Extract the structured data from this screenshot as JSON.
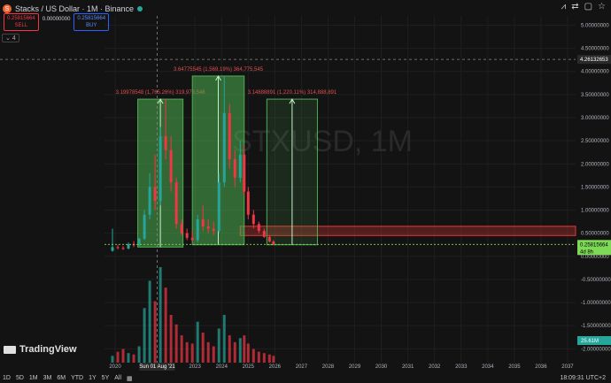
{
  "header": {
    "symbol_letter": "S",
    "title": "Stacks / US Dollar · 1M · Binance"
  },
  "trade": {
    "sell_price": "0.25815664",
    "sell_label": "SELL",
    "spread": "0.00000000",
    "buy_price": "0.25815664",
    "buy_label": "BUY"
  },
  "indicator_badge": "4",
  "toolbar_icons": [
    "trend-icon",
    "compare-icon",
    "square-icon",
    "star-icon"
  ],
  "logo_text": "TradingView",
  "bottom": {
    "periods": [
      "1D",
      "5D",
      "1M",
      "3M",
      "6M",
      "YTD",
      "1Y",
      "5Y",
      "All"
    ],
    "clock": "18:09:31 UTC+2"
  },
  "colors": {
    "up": "#26a69a",
    "down": "#f23645",
    "range_fill": "#4caf50",
    "resistance": "#e53935",
    "price_tag": "#7ed957",
    "volume_tag": "#26a69a"
  },
  "chart_data": {
    "type": "candlestick",
    "watermark": "STXUSD, 1M",
    "ylim": [
      -2.3,
      5.2
    ],
    "yticks": [
      {
        "v": 5.0,
        "label": "5.00000000"
      },
      {
        "v": 4.5,
        "label": "4.50000000"
      },
      {
        "v": 4.0,
        "label": "4.00000000"
      },
      {
        "v": 3.5,
        "label": "3.50000000"
      },
      {
        "v": 3.0,
        "label": "3.00000000"
      },
      {
        "v": 2.5,
        "label": "2.50000000"
      },
      {
        "v": 2.0,
        "label": "2.00000000"
      },
      {
        "v": 1.5,
        "label": "1.50000000"
      },
      {
        "v": 1.0,
        "label": "1.00000000"
      },
      {
        "v": 0.5,
        "label": "0.50000000"
      },
      {
        "v": 0.0,
        "label": "0.00000000"
      },
      {
        "v": -0.5,
        "label": "-0.50000000"
      },
      {
        "v": -1.0,
        "label": "-1.00000000"
      },
      {
        "v": -1.5,
        "label": "-1.50000000"
      },
      {
        "v": -2.0,
        "label": "-2.00000000"
      }
    ],
    "xlim": [
      2019.6,
      2037.3
    ],
    "xticks": [
      {
        "v": 2020,
        "label": "2020"
      },
      {
        "v": 2023,
        "label": "2023"
      },
      {
        "v": 2024,
        "label": "2024"
      },
      {
        "v": 2025,
        "label": "2025"
      },
      {
        "v": 2026,
        "label": "2026"
      },
      {
        "v": 2027,
        "label": "2027"
      },
      {
        "v": 2028,
        "label": "2028"
      },
      {
        "v": 2029,
        "label": "2029"
      },
      {
        "v": 2030,
        "label": "2030"
      },
      {
        "v": 2031,
        "label": "2031"
      },
      {
        "v": 2032,
        "label": "2032"
      },
      {
        "v": 2033,
        "label": "2033"
      },
      {
        "v": 2034,
        "label": "2034"
      },
      {
        "v": 2035,
        "label": "2035"
      },
      {
        "v": 2036,
        "label": "2036"
      },
      {
        "v": 2037,
        "label": "2037"
      }
    ],
    "crosshair": {
      "x": 2021.58,
      "y": 4.26,
      "x_label": "Sun 01 Aug '21",
      "y_label": "4.26132653"
    },
    "current_price": {
      "v": 0.258,
      "label": "0.25815664",
      "countdown": "4d 8h"
    },
    "volume_label": "25.61M",
    "resistance_zone": {
      "x0": 2024.7,
      "x1": 2037.3,
      "y0": 0.45,
      "y1": 0.65
    },
    "ranges": [
      {
        "x0": 2020.85,
        "x1": 2022.55,
        "y0": 0.2,
        "y1": 3.4,
        "label": "3.19978548 (1,765.26%) 319,978,548"
      },
      {
        "x0": 2022.9,
        "x1": 2024.85,
        "y0": 0.25,
        "y1": 3.9,
        "label": "3.64775545 (1,569.19%) 364,775,545"
      },
      {
        "x0": 2025.7,
        "x1": 2027.6,
        "y0": 0.25,
        "y1": 3.4,
        "label": "3.14888891 (1,220.11%) 314,888,891"
      }
    ],
    "series": [
      {
        "name": "",
        "points": [
          [
            2019.9,
            0.12,
            0.6,
            0.1,
            0.2
          ],
          [
            2020.1,
            0.2,
            0.25,
            0.15,
            0.18
          ],
          [
            2020.3,
            0.18,
            0.22,
            0.14,
            0.17
          ],
          [
            2020.5,
            0.17,
            0.3,
            0.15,
            0.26
          ],
          [
            2020.7,
            0.26,
            0.33,
            0.2,
            0.24
          ],
          [
            2020.9,
            0.24,
            0.4,
            0.22,
            0.38
          ],
          [
            2021.1,
            0.38,
            1.0,
            0.35,
            0.9
          ],
          [
            2021.3,
            0.9,
            1.8,
            0.8,
            1.5
          ],
          [
            2021.5,
            1.5,
            2.2,
            1.0,
            1.2
          ],
          [
            2021.7,
            1.2,
            2.8,
            1.1,
            2.6
          ],
          [
            2021.9,
            2.6,
            3.4,
            2.1,
            2.3
          ],
          [
            2022.1,
            2.3,
            2.6,
            1.4,
            1.6
          ],
          [
            2022.3,
            1.6,
            1.7,
            0.6,
            0.7
          ],
          [
            2022.5,
            0.7,
            0.8,
            0.45,
            0.5
          ],
          [
            2022.7,
            0.5,
            0.6,
            0.35,
            0.4
          ],
          [
            2022.9,
            0.4,
            0.55,
            0.3,
            0.35
          ],
          [
            2023.1,
            0.35,
            0.9,
            0.3,
            0.8
          ],
          [
            2023.3,
            0.8,
            1.1,
            0.55,
            0.65
          ],
          [
            2023.5,
            0.65,
            0.8,
            0.5,
            0.6
          ],
          [
            2023.7,
            0.6,
            0.75,
            0.45,
            0.55
          ],
          [
            2023.9,
            0.55,
            1.8,
            0.5,
            1.6
          ],
          [
            2024.1,
            1.6,
            3.9,
            1.5,
            3.1
          ],
          [
            2024.3,
            3.1,
            3.3,
            1.9,
            2.1
          ],
          [
            2024.5,
            2.1,
            2.3,
            1.5,
            1.7
          ],
          [
            2024.7,
            1.7,
            2.5,
            1.6,
            2.2
          ],
          [
            2024.85,
            2.2,
            2.4,
            1.3,
            1.4
          ],
          [
            2025.0,
            1.4,
            1.5,
            0.8,
            0.9
          ],
          [
            2025.2,
            0.9,
            1.0,
            0.6,
            0.7
          ],
          [
            2025.4,
            0.7,
            0.75,
            0.5,
            0.55
          ],
          [
            2025.6,
            0.55,
            0.6,
            0.4,
            0.42
          ],
          [
            2025.8,
            0.42,
            0.45,
            0.3,
            0.32
          ],
          [
            2025.95,
            0.32,
            0.35,
            0.24,
            0.26
          ]
        ]
      }
    ],
    "volume": [
      [
        2019.9,
        0.05
      ],
      [
        2020.1,
        0.08
      ],
      [
        2020.3,
        0.1
      ],
      [
        2020.5,
        0.07
      ],
      [
        2020.7,
        0.06
      ],
      [
        2020.9,
        0.12
      ],
      [
        2021.1,
        0.4
      ],
      [
        2021.3,
        0.6
      ],
      [
        2021.5,
        0.45
      ],
      [
        2021.7,
        0.7
      ],
      [
        2021.9,
        0.55
      ],
      [
        2022.1,
        0.35
      ],
      [
        2022.3,
        0.28
      ],
      [
        2022.5,
        0.2
      ],
      [
        2022.7,
        0.15
      ],
      [
        2022.9,
        0.14
      ],
      [
        2023.1,
        0.3
      ],
      [
        2023.3,
        0.22
      ],
      [
        2023.5,
        0.15
      ],
      [
        2023.7,
        0.12
      ],
      [
        2023.9,
        0.25
      ],
      [
        2024.1,
        0.35
      ],
      [
        2024.3,
        0.2
      ],
      [
        2024.5,
        0.15
      ],
      [
        2024.7,
        0.18
      ],
      [
        2024.85,
        0.2
      ],
      [
        2025.0,
        0.14
      ],
      [
        2025.2,
        0.1
      ],
      [
        2025.4,
        0.08
      ],
      [
        2025.6,
        0.07
      ],
      [
        2025.8,
        0.06
      ],
      [
        2025.95,
        0.05
      ]
    ]
  }
}
